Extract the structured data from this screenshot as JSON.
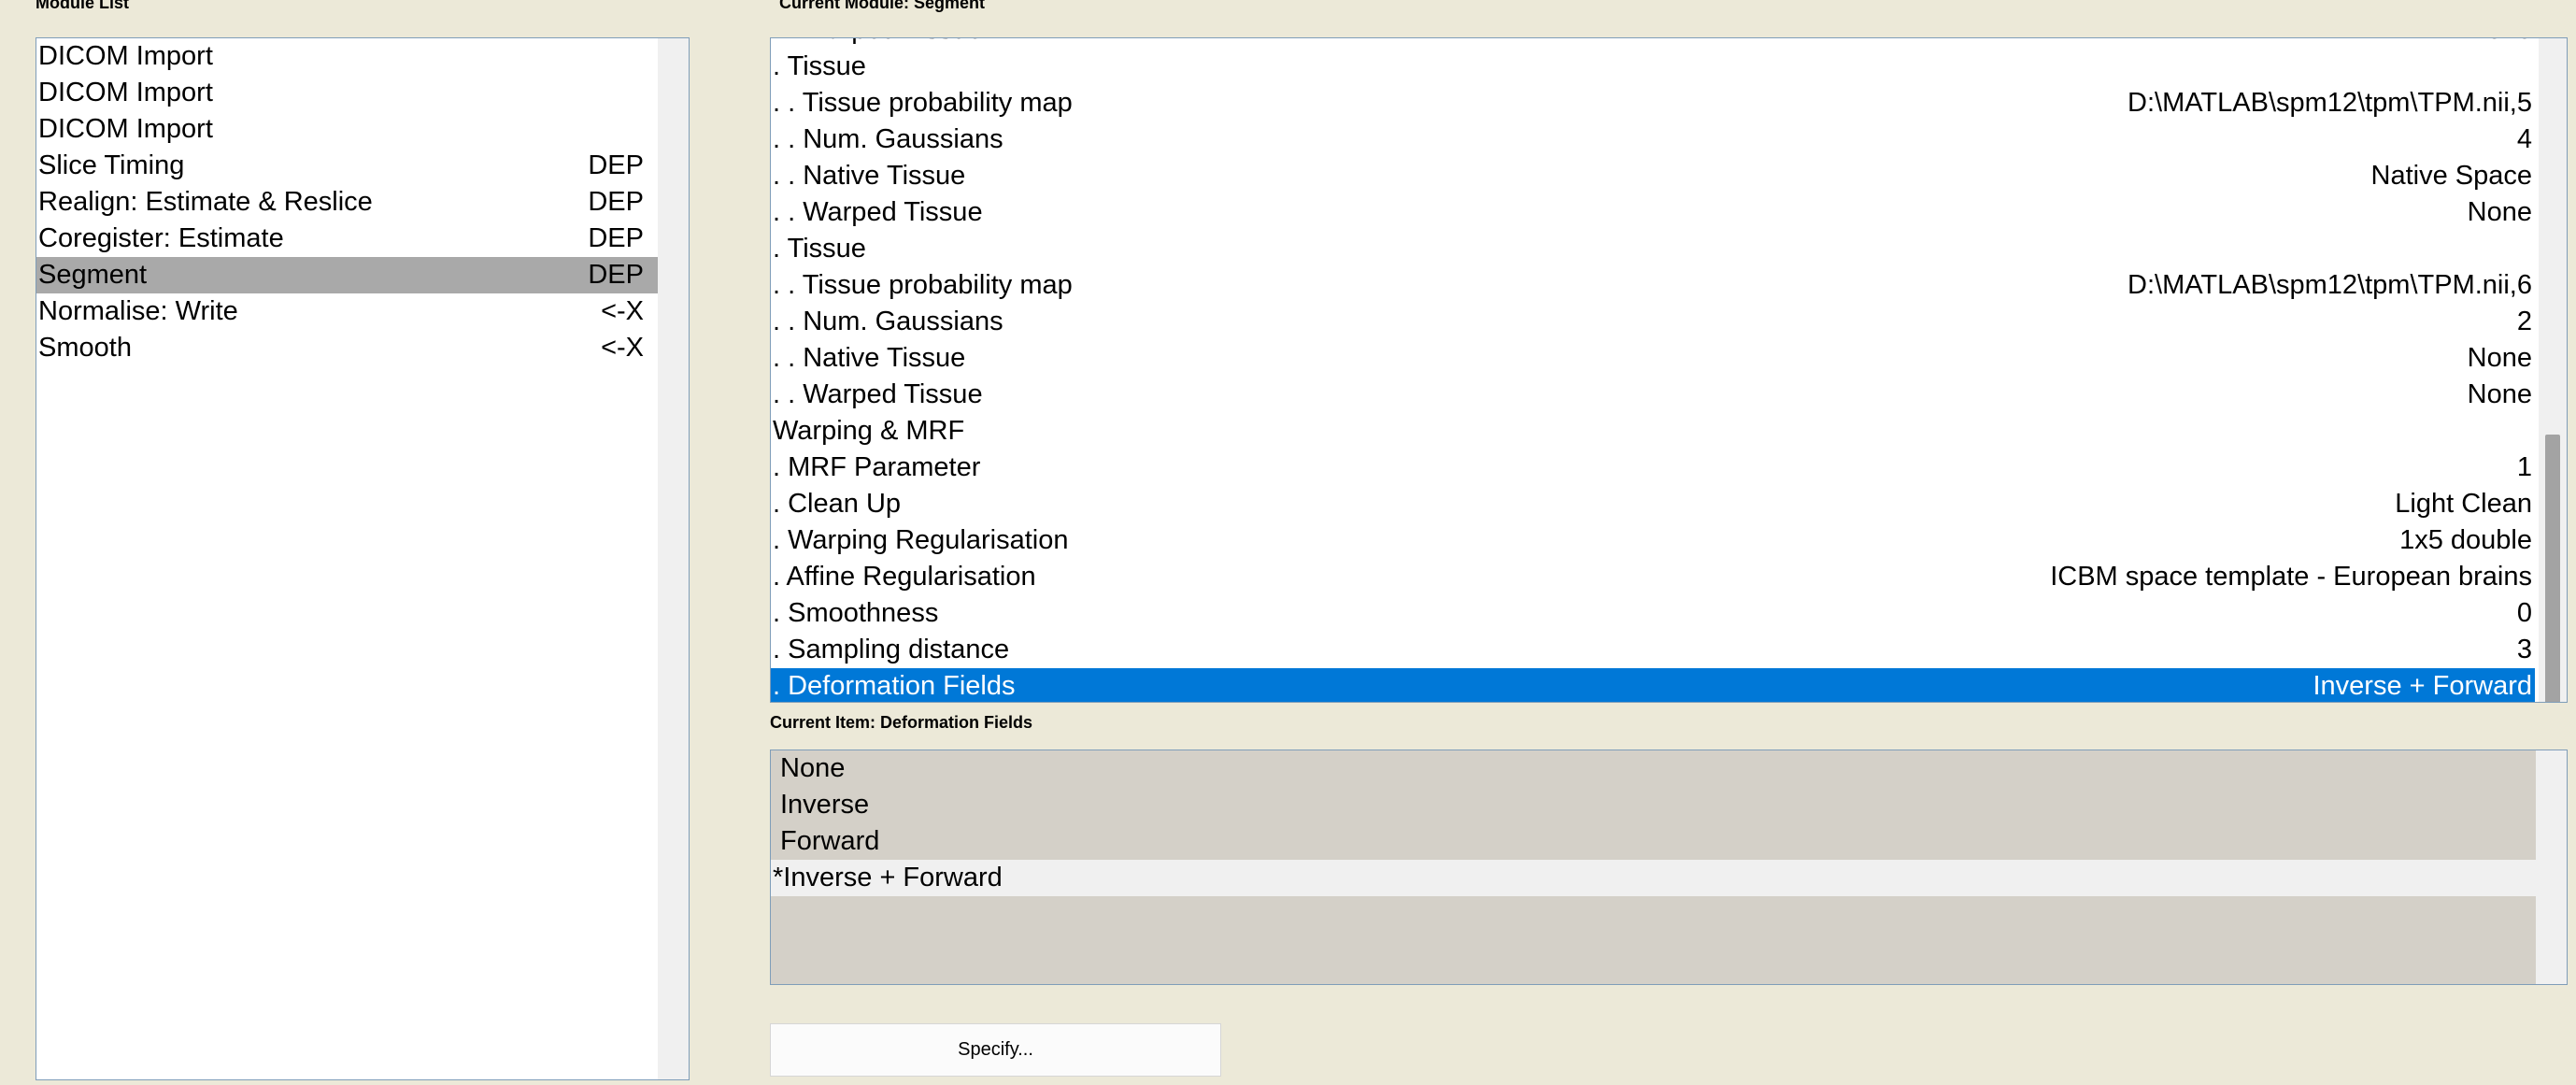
{
  "module_list": {
    "label": "Module List",
    "items": [
      {
        "name": "DICOM Import",
        "status": ""
      },
      {
        "name": "DICOM Import",
        "status": ""
      },
      {
        "name": "DICOM Import",
        "status": ""
      },
      {
        "name": "Slice Timing",
        "status": "DEP"
      },
      {
        "name": "Realign: Estimate & Reslice",
        "status": "DEP"
      },
      {
        "name": "Coregister: Estimate",
        "status": "DEP"
      },
      {
        "name": "Segment",
        "status": "DEP"
      },
      {
        "name": "Normalise: Write",
        "status": "<-X"
      },
      {
        "name": "Smooth",
        "status": "<-X"
      }
    ],
    "selected_index": 6
  },
  "current_module": {
    "label": "Current Module: Segment",
    "rows": [
      {
        "name": ". . Warped Tissue",
        "value": "None"
      },
      {
        "name": ". Tissue",
        "value": ""
      },
      {
        "name": ". . Tissue probability map",
        "value": "D:\\MATLAB\\spm12\\tpm\\TPM.nii,5"
      },
      {
        "name": ". . Num. Gaussians",
        "value": "4"
      },
      {
        "name": ". . Native Tissue",
        "value": "Native Space"
      },
      {
        "name": ". . Warped Tissue",
        "value": "None"
      },
      {
        "name": ". Tissue",
        "value": ""
      },
      {
        "name": ". . Tissue probability map",
        "value": "D:\\MATLAB\\spm12\\tpm\\TPM.nii,6"
      },
      {
        "name": ". . Num. Gaussians",
        "value": "2"
      },
      {
        "name": ". . Native Tissue",
        "value": "None"
      },
      {
        "name": ". . Warped Tissue",
        "value": "None"
      },
      {
        "name": "Warping & MRF",
        "value": ""
      },
      {
        "name": ". MRF Parameter",
        "value": "1"
      },
      {
        "name": ". Clean Up",
        "value": "Light Clean"
      },
      {
        "name": ". Warping Regularisation",
        "value": "1x5 double"
      },
      {
        "name": ". Affine Regularisation",
        "value": "ICBM space template - European brains"
      },
      {
        "name": ". Smoothness",
        "value": "0"
      },
      {
        "name": ". Sampling distance",
        "value": "3"
      },
      {
        "name": ". Deformation Fields",
        "value": "Inverse + Forward"
      }
    ],
    "selected_index": 18
  },
  "current_item": {
    "label": "Current Item: Deformation Fields",
    "options": [
      "None",
      "Inverse",
      "Forward",
      "*Inverse + Forward"
    ],
    "selected_index": 3
  },
  "buttons": {
    "specify_label": "Specify..."
  },
  "colors": {
    "background": "#ece9d8",
    "selection_blue": "#0078d7",
    "module_selected_gray": "#a9a9a9",
    "item_box_gray": "#d4d0c8"
  }
}
